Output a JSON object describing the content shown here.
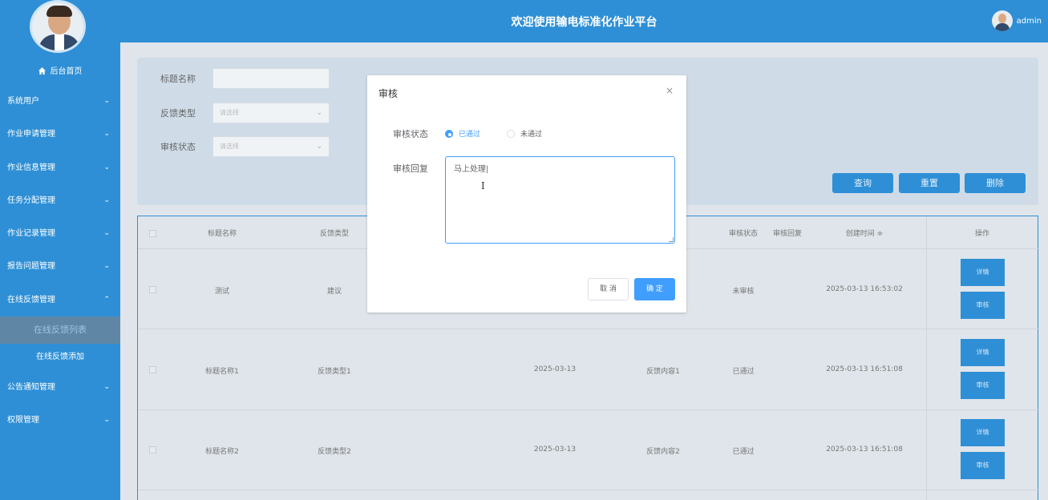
{
  "header": {
    "title": "欢迎使用输电标准化作业平台",
    "username": "admin"
  },
  "sidebar": {
    "home_label": "后台首页",
    "items": [
      {
        "label": "系统用户",
        "chevron": "⌄"
      },
      {
        "label": "作业申请管理",
        "chevron": "⌄"
      },
      {
        "label": "作业信息管理",
        "chevron": "⌄"
      },
      {
        "label": "任务分配管理",
        "chevron": "⌄"
      },
      {
        "label": "作业记录管理",
        "chevron": "⌄"
      },
      {
        "label": "报告问题管理",
        "chevron": "⌄"
      },
      {
        "label": "在线反馈管理",
        "chevron": "⌃"
      }
    ],
    "sub_items": [
      "在线反馈列表",
      "在线反馈添加"
    ],
    "items_after": [
      {
        "label": "公告通知管理",
        "chevron": "⌄"
      },
      {
        "label": "权限管理",
        "chevron": "⌄"
      }
    ]
  },
  "search": {
    "title_label": "标题名称",
    "title_value": "",
    "type_label": "反馈类型",
    "type_placeholder": "请选择",
    "status_label": "审核状态",
    "status_placeholder": "请选择",
    "query_button": "查询",
    "reset_button": "重置",
    "delete_button": "删除"
  },
  "table": {
    "headers": [
      "标题名称",
      "反馈类型",
      "审核状态",
      "审核回复",
      "创建时间 ≑",
      "操作"
    ],
    "rows": [
      {
        "title": "测试",
        "type": "建议",
        "date": "",
        "content": "",
        "status": "未审核",
        "created": "2025-03-13 16:53:02",
        "detail": "详情",
        "review": "审核"
      },
      {
        "title": "标题名称1",
        "type": "反馈类型1",
        "date": "2025-03-13",
        "content": "反馈内容1",
        "status": "已通过",
        "created": "2025-03-13 16:51:08",
        "detail": "详情",
        "review": "审核"
      },
      {
        "title": "标题名称2",
        "type": "反馈类型2",
        "date": "2025-03-13",
        "content": "反馈内容2",
        "status": "已通过",
        "created": "2025-03-13 16:51:08",
        "detail": "详情",
        "review": "审核"
      }
    ]
  },
  "dialog": {
    "title": "审核",
    "close": "×",
    "status_label": "审核状态",
    "option_pass": "已通过",
    "option_fail": "未通过",
    "selected": "已通过",
    "reply_label": "审核回复",
    "reply_value": "马上处理|",
    "cancel_button": "取 消",
    "ok_button": "确 定"
  },
  "colors": {
    "accent": "#2e8fd6",
    "primary": "#409eff"
  }
}
